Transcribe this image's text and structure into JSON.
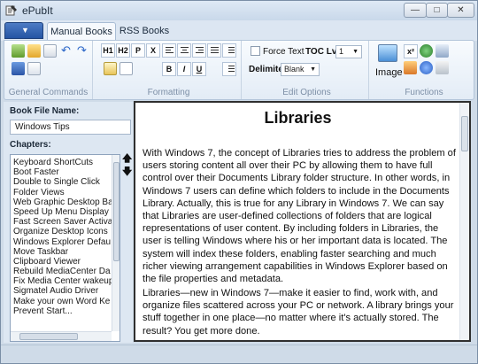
{
  "window": {
    "title": "ePubIt",
    "min_glyph": "—",
    "max_glyph": "□",
    "close_glyph": "✕"
  },
  "tabs": [
    {
      "label": "Manual Books",
      "active": true
    },
    {
      "label": "RSS Books",
      "active": false
    }
  ],
  "ribbon": {
    "groups": {
      "general": "General Commands",
      "formatting": "Formatting",
      "edit": "Edit Options",
      "functions": "Functions"
    },
    "format_buttons": {
      "h1": "H1",
      "h2": "H2",
      "p": "P",
      "x": "X",
      "bold": "B",
      "italic": "I",
      "underline": "U"
    },
    "force_text": "Force Text",
    "toc_lvl_label": "TOC Lvl",
    "toc_lvl_value": "1",
    "delimiter_label": "Delimiter",
    "delimiter_value": "Blank",
    "image_label": "Image",
    "superscript": "x²"
  },
  "left": {
    "book_file_label": "Book File Name:",
    "book_file_value": "Windows Tips",
    "chapters_label": "Chapters:",
    "chapters": [
      "Keyboard ShortCuts",
      "Boot Faster",
      "Double to Single Click",
      "Folder Views",
      "Web Graphic Desktop Ba",
      "Speed Up Menu Display",
      "Fast Screen Saver Activat",
      "Organize Desktop Icons",
      "Windows Explorer Defau",
      "Move Taskbar",
      "Clipboard Viewer",
      "Rebuild MediaCenter Da",
      "Fix Media Center wakeup",
      "Sigmatel Audio Driver",
      "Make your own Word Ke",
      "Prevent Start..."
    ],
    "move_up": "🡅",
    "move_down": "🡇"
  },
  "content": {
    "title": "Libraries",
    "paragraph1": "With Windows 7, the concept of Libraries tries to address the problem of users storing content all over their PC by allowing them to have full control over their Documents Library folder structure. In other words, in Windows 7 users can define which folders to include in the Documents Library. Actually, this is true for any Library in Windows 7. We can say that Libraries are user-defined collections of folders that are logical representations of user content. By including folders in Libraries, the user is telling Windows where his or her important data is located. The system will index these folders, enabling faster searching and much richer viewing arrangement capabilities in Windows Explorer based on the file properties and metadata.",
    "paragraph2": "Libraries—new in Windows 7—make it easier to find, work with, and organize files scattered across your PC or network. A library brings your stuff together in one place—no matter where it's actually stored. The result? You get more done."
  },
  "colors": {
    "accent": "#2555a4",
    "ribbon_bg": "#e3ecf6",
    "frame": "#cfdbe8"
  }
}
